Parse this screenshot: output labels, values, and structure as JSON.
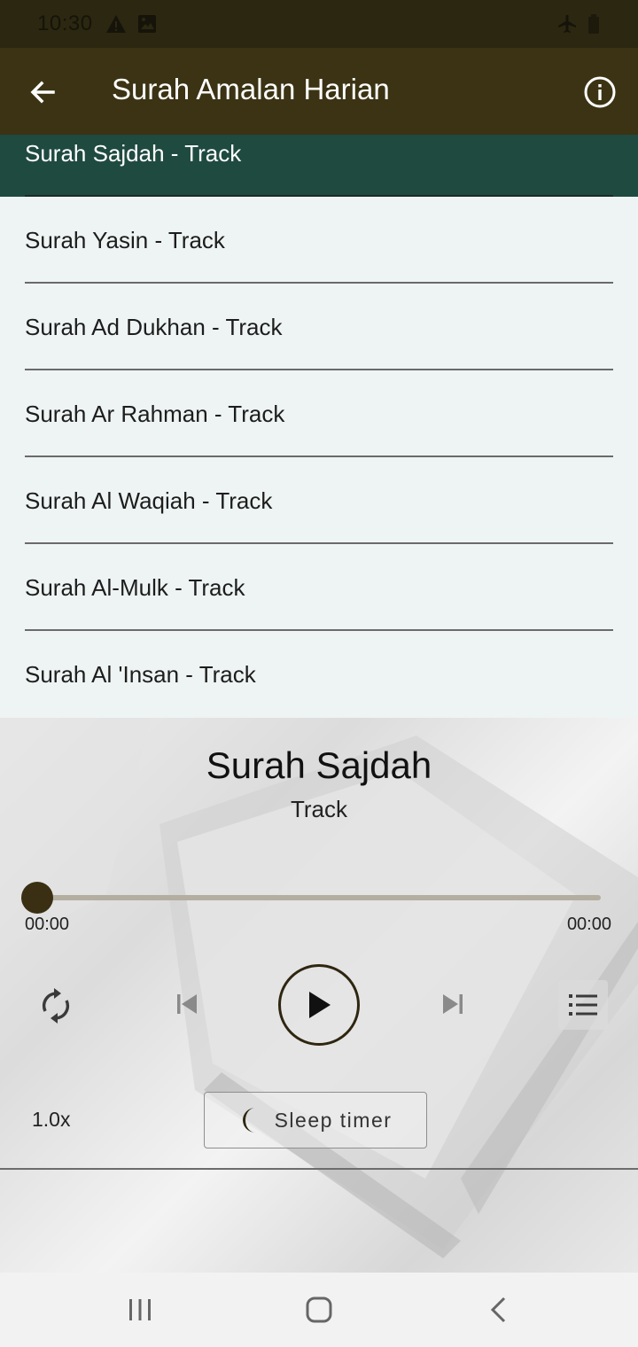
{
  "status_bar": {
    "time": "10:30",
    "left_icons": [
      "warning-icon",
      "image-icon"
    ],
    "right_icons": [
      "airplane-icon",
      "battery-icon"
    ]
  },
  "app_bar": {
    "title": "Surah Amalan Harian",
    "back_icon": "back-arrow-icon",
    "info_icon": "info-icon"
  },
  "tracks": [
    {
      "label": "Surah Sajdah - Track",
      "active": true
    },
    {
      "label": "Surah Yasin - Track",
      "active": false
    },
    {
      "label": "Surah Ad Dukhan - Track",
      "active": false
    },
    {
      "label": "Surah Ar Rahman - Track",
      "active": false
    },
    {
      "label": "Surah Al Waqiah - Track",
      "active": false
    },
    {
      "label": "Surah Al-Mulk - Track",
      "active": false
    },
    {
      "label": "Surah Al 'Insan - Track",
      "active": false
    }
  ],
  "player": {
    "title": "Surah Sajdah",
    "subtitle": "Track",
    "position": "00:00",
    "duration": "00:00",
    "progress": 0,
    "speed": "1.0x",
    "sleep_timer_label": "Sleep timer"
  },
  "colors": {
    "app_bar": "#3b3313",
    "active_track": "#1f4a40",
    "accent": "#3a2f12"
  },
  "nav_bar": {
    "icons": [
      "recent-apps-icon",
      "home-icon",
      "back-nav-icon"
    ]
  }
}
